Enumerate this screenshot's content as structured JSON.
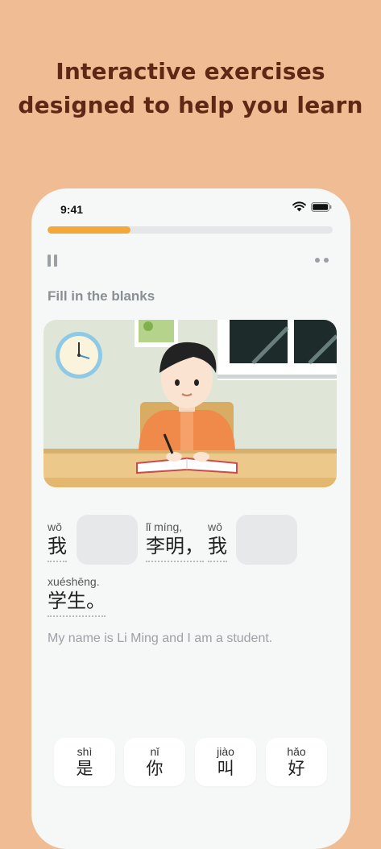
{
  "headline": {
    "line1": "Interactive exercises",
    "line2": "designed to help you learn"
  },
  "status_bar": {
    "time": "9:41"
  },
  "progress": {
    "fraction": 0.29,
    "color": "#f5a83a"
  },
  "exercise": {
    "instruction": "Fill in the blanks",
    "sentence": [
      {
        "pinyin": "wǒ",
        "hanzi": "我"
      },
      {
        "blank": true
      },
      {
        "pinyin": "lǐ míng,",
        "hanzi": "李明，"
      },
      {
        "pinyin": "wǒ",
        "hanzi": "我"
      },
      {
        "blank": true
      },
      {
        "pinyin": "xuéshēng.",
        "hanzi": "学生。"
      }
    ],
    "translation": "My name is Li Ming and I am a student."
  },
  "choices": [
    {
      "pinyin": "shì",
      "hanzi": "是"
    },
    {
      "pinyin": "nǐ",
      "hanzi": "你"
    },
    {
      "pinyin": "jiào",
      "hanzi": "叫"
    },
    {
      "pinyin": "hǎo",
      "hanzi": "好"
    }
  ],
  "icons": {
    "wifi": "wifi-icon",
    "battery": "battery-icon",
    "pause": "pause-icon",
    "more": "more-icon"
  },
  "colors": {
    "background": "#efbc93",
    "headline": "#5e2716",
    "accent": "#f5a83a"
  }
}
